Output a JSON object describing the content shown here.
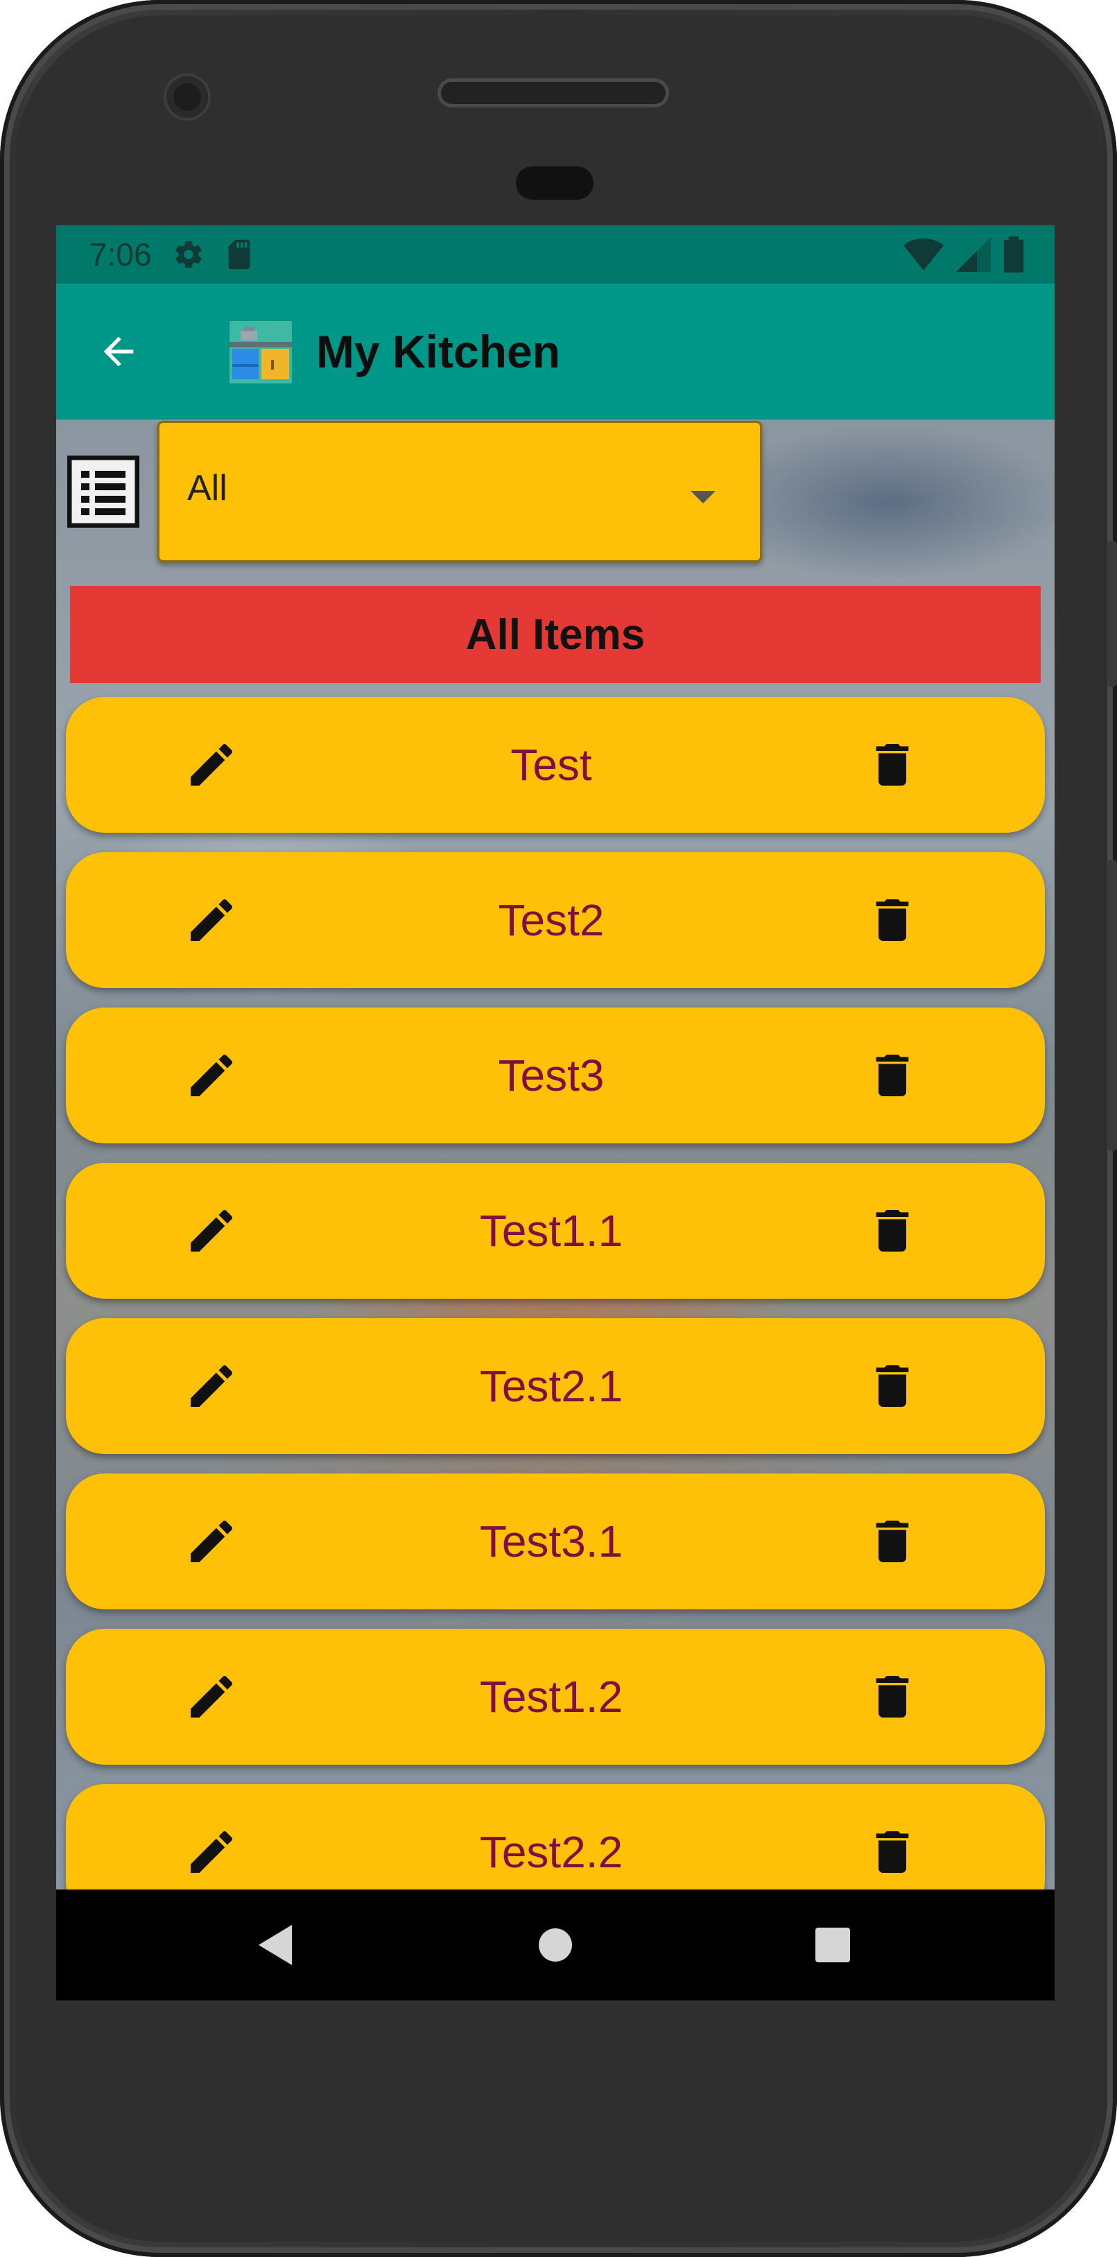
{
  "status_bar": {
    "time": "7:06"
  },
  "app_bar": {
    "title": "My Kitchen"
  },
  "filter": {
    "selected_value": "All"
  },
  "section": {
    "title": "All Items"
  },
  "items": [
    {
      "name": "Test"
    },
    {
      "name": "Test2"
    },
    {
      "name": "Test3"
    },
    {
      "name": "Test1.1"
    },
    {
      "name": "Test2.1"
    },
    {
      "name": "Test3.1"
    },
    {
      "name": "Test1.2"
    },
    {
      "name": "Test2.2"
    }
  ],
  "colors": {
    "status_bar": "#00796b",
    "app_bar": "#009688",
    "card": "#ffc107",
    "header": "#e53935",
    "item_text": "#800f3f"
  },
  "icons": {
    "back": "arrow-left-icon",
    "logo": "kitchen-cabinet-icon",
    "list": "list-view-icon",
    "edit": "pencil-icon",
    "delete": "trash-icon",
    "nav_back": "triangle-back-icon",
    "nav_home": "circle-home-icon",
    "nav_recents": "square-recents-icon"
  }
}
